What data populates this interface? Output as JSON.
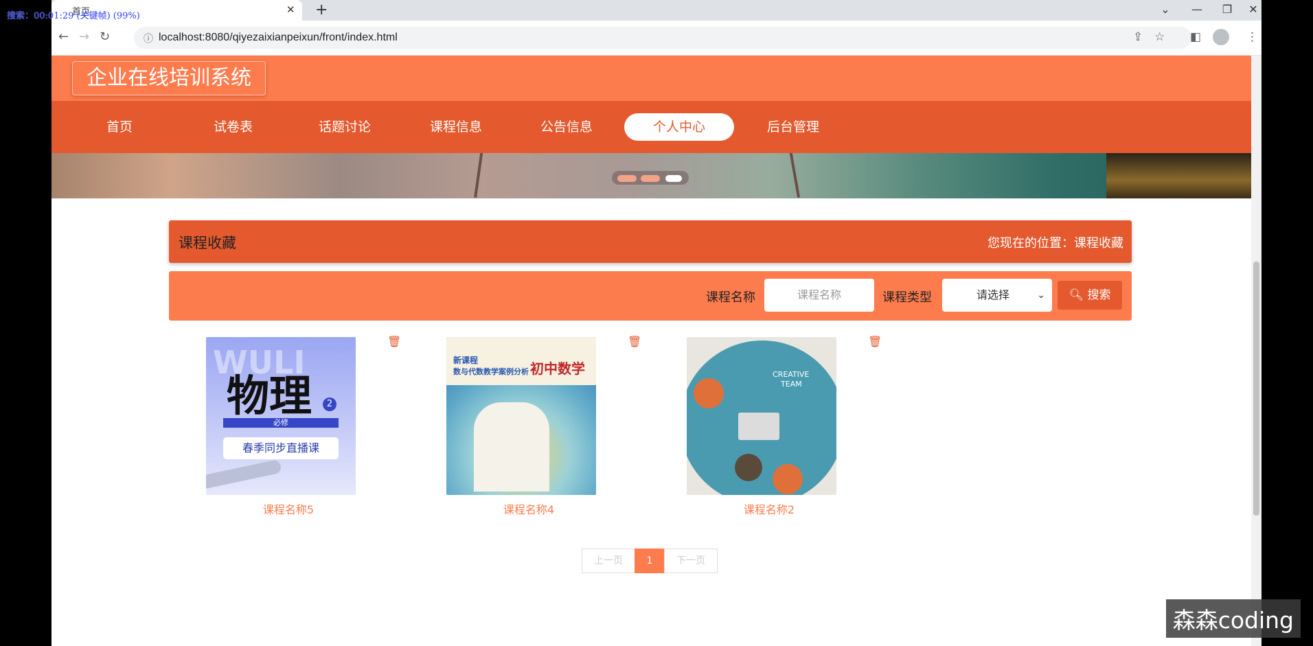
{
  "overlay": {
    "recording": "搜索：00:01:29 (关键帧) (99%)",
    "watermark": "森森coding"
  },
  "browser": {
    "tab_title": "首页",
    "tab_close": "✕",
    "new_tab": "+",
    "url": "localhost:8080/qiyezaixianpeixun/front/index.html"
  },
  "site": {
    "title": "企业在线培训系统",
    "nav": [
      "首页",
      "试卷表",
      "话题讨论",
      "课程信息",
      "公告信息",
      "个人中心",
      "后台管理"
    ],
    "active_nav": "个人中心"
  },
  "section": {
    "title": "课程收藏",
    "position": "您现在的位置：课程收藏"
  },
  "search": {
    "name_label": "课程名称",
    "name_placeholder": "课程名称",
    "type_label": "课程类型",
    "type_value": "请选择",
    "button": "搜索"
  },
  "cards": [
    {
      "name": "课程名称5",
      "cover_text": "物理",
      "cover_sub": "必修",
      "cover_course": "春季同步直播课",
      "cover_bg_text": "WULI",
      "cover_badge": "2"
    },
    {
      "name": "课程名称4",
      "cover_text": "初中数学",
      "cover_sub": "数与代数教学案例分析",
      "cover_tag": "新课程"
    },
    {
      "name": "课程名称2",
      "cover_text": "CREATIVE",
      "cover_sub": "TEAM"
    }
  ],
  "pager": {
    "prev": "上一页",
    "current": "1",
    "next": "下一页"
  },
  "colors": {
    "header": "#fd7c4e",
    "nav": "#e45a2e",
    "accent": "#fd7c4e"
  }
}
